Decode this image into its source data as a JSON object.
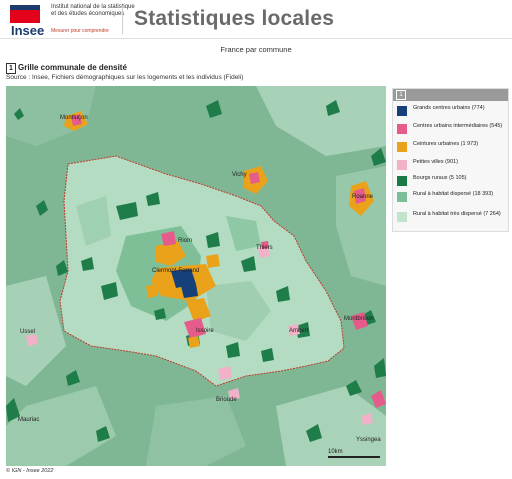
{
  "header": {
    "logo_text": "Insee",
    "institute_line1": "Institut national de la statistique",
    "institute_line2": "et des études économiques",
    "tagline": "Mesurer pour comprendre",
    "app_title": "Statistiques locales"
  },
  "subtitle": "France par commune",
  "map": {
    "number": "1",
    "title": "Grille communale de densité",
    "source": "Source : Insee, Fichiers démographiques sur les logements et les individus (Fideli)",
    "scale_label": "10km",
    "cities": [
      "Montluçon",
      "Vichy",
      "Roanne",
      "Riom",
      "Thiers",
      "Clermont-Ferrand",
      "Issoire",
      "Ambert",
      "Montbrison",
      "Ussel",
      "Brioude",
      "Mauriac",
      "Yssingea"
    ]
  },
  "legend": {
    "number": "1",
    "items": [
      {
        "label": "Grands centres urbains (774)",
        "color": "#16407a"
      },
      {
        "label": "Centres urbains intermédiaires (545)",
        "color": "#e55b8a"
      },
      {
        "label": "Ceintures urbaines (1 973)",
        "color": "#eaa21b"
      },
      {
        "label": "Petites villes (901)",
        "color": "#f1b1c8"
      },
      {
        "label": "Bourgs ruraux (5 105)",
        "color": "#1a7a45"
      },
      {
        "label": "Rural à habitat dispersé (18 393)",
        "color": "#7cbf97"
      },
      {
        "label": "Rural à habitat très dispersé (7 264)",
        "color": "#c2e4cd"
      }
    ]
  },
  "credit": "© IGN - Insee 2022"
}
